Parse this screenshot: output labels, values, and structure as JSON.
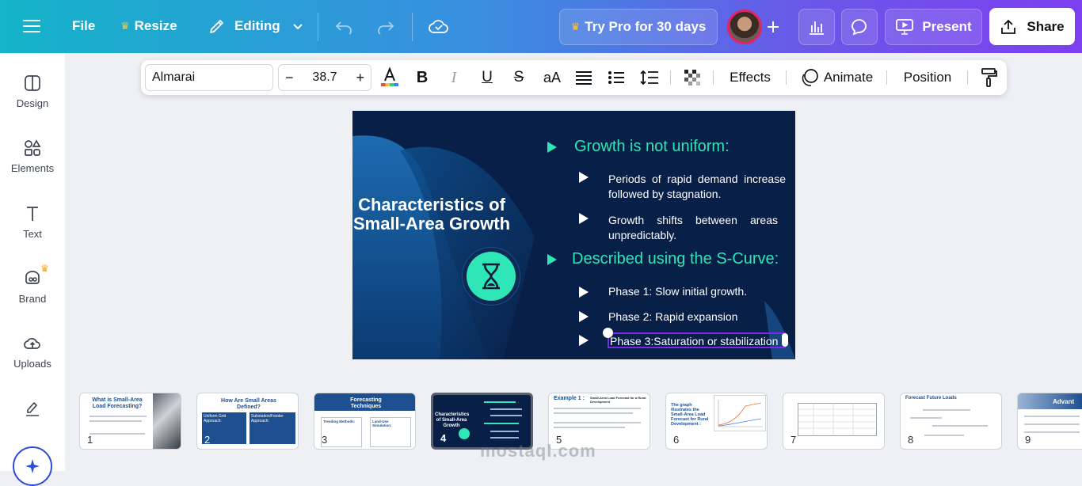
{
  "topbar": {
    "file": "File",
    "resize": "Resize",
    "editing": "Editing",
    "try_pro": "Try Pro for 30 days",
    "present": "Present",
    "share": "Share"
  },
  "sidebar": {
    "items": [
      {
        "label": "Design",
        "icon": "layout-icon"
      },
      {
        "label": "Elements",
        "icon": "shapes-icon"
      },
      {
        "label": "Text",
        "icon": "text-icon"
      },
      {
        "label": "Brand",
        "icon": "brand-icon"
      },
      {
        "label": "Uploads",
        "icon": "cloud-upload-icon"
      }
    ]
  },
  "toolbar": {
    "font": "Almarai",
    "font_size": "38.7",
    "minus": "−",
    "plus": "+",
    "case": "aA",
    "effects": "Effects",
    "animate": "Animate",
    "position": "Position"
  },
  "slide": {
    "title": "Characteristics of Small-Area Growth",
    "heading1": "Growth is not uniform:",
    "bullets1": [
      "Periods of rapid demand increase followed by stagnation.",
      "Growth shifts between areas unpredictably."
    ],
    "heading2": "Described using the S-Curve:",
    "bullets2": [
      "Phase 1: Slow initial growth.",
      "Phase 2: Rapid expansion",
      "Phase 3:Saturation or stabilization"
    ]
  },
  "thumbnails": [
    {
      "num": "1",
      "title": "What is Small-Area Load Forecasting?"
    },
    {
      "num": "2",
      "title": "How Are Small Areas Defined?",
      "sub": [
        "Uniform Grid Approach:",
        "Substation/Feeder Approach:"
      ]
    },
    {
      "num": "3",
      "title": "Forecasting Techniques",
      "sub": [
        "Trending Methods:",
        "Land-Use Simulation:"
      ]
    },
    {
      "num": "4",
      "title": "Characteristics of Small-Area Growth"
    },
    {
      "num": "5",
      "title": "Example 1 :",
      "subtitle": "Small-Area Load Forecast for a Rural Development"
    },
    {
      "num": "6",
      "title": "The graph illustrates the Small-Area Load Forecast for Rural Development :"
    },
    {
      "num": "7",
      "title": ""
    },
    {
      "num": "8",
      "title": "Forecast Future Loads"
    },
    {
      "num": "9",
      "title": "Advant"
    }
  ],
  "watermark": "mostaql.com",
  "colors": {
    "accent": "#7d2ae8",
    "teal": "#2ee6b6",
    "slide_bg": "#082048"
  }
}
